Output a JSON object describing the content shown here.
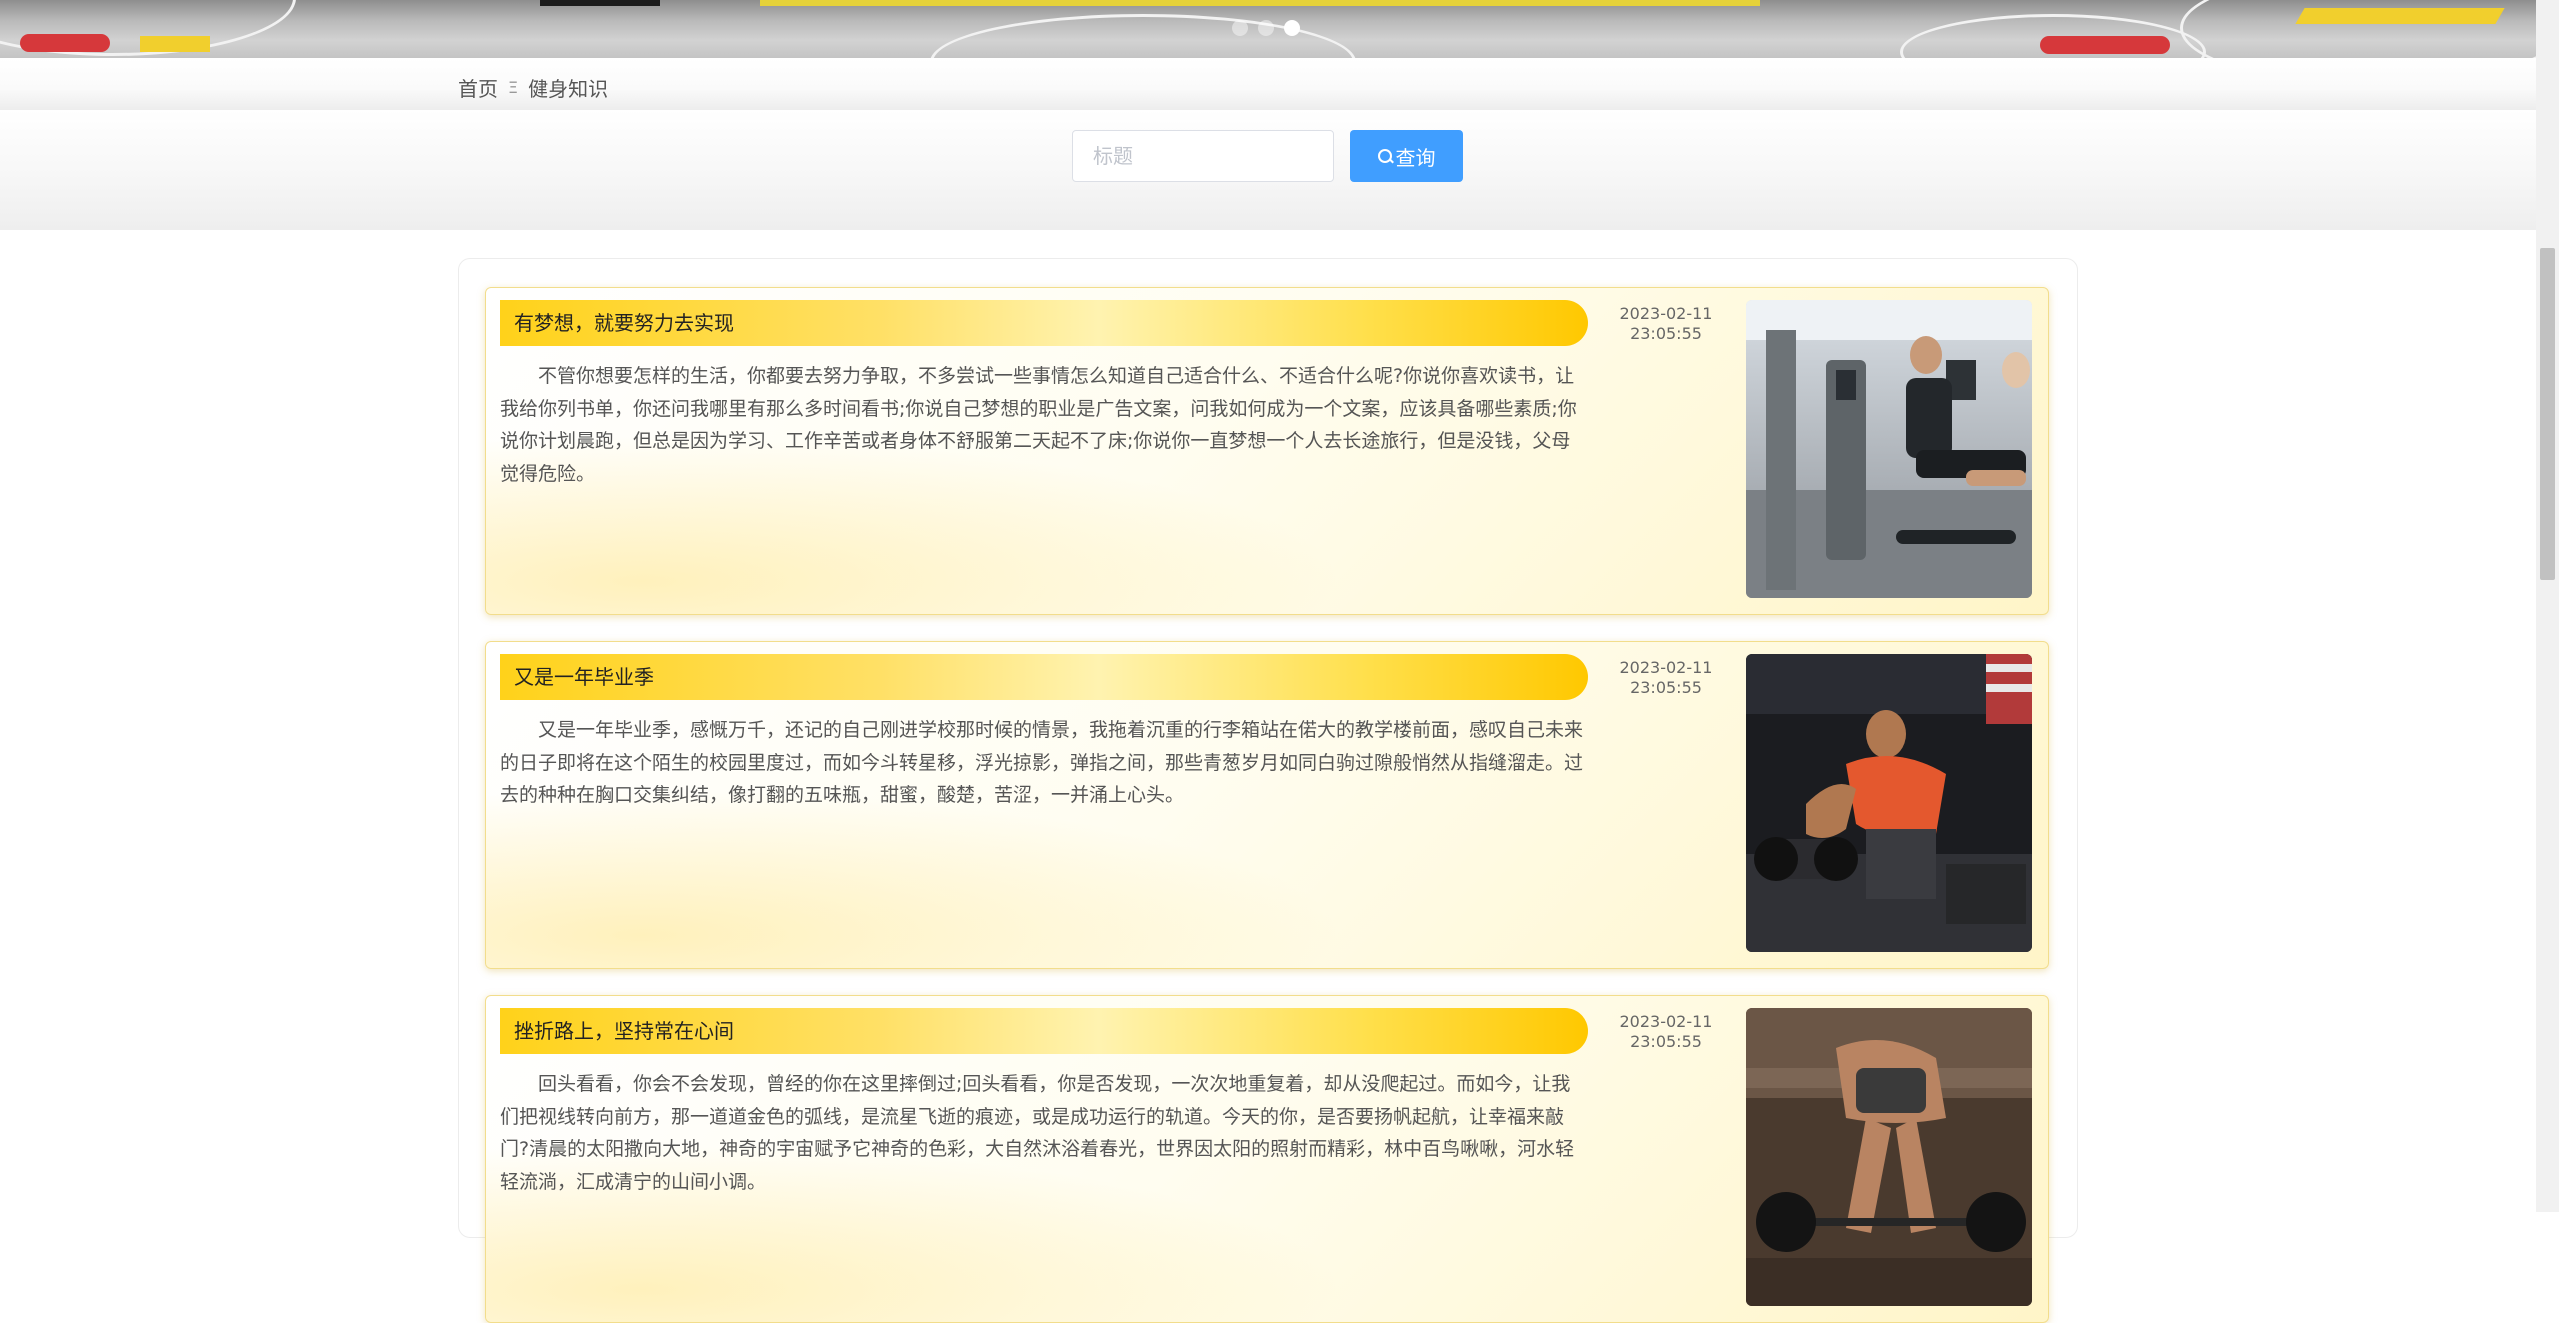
{
  "banner": {
    "carousel_dots": 3,
    "active_dot": 3
  },
  "breadcrumb": {
    "home_label": "首页",
    "separator": "Ξ",
    "current_label": "健身知识"
  },
  "search": {
    "placeholder": "标题",
    "value": "",
    "button_label": "查询"
  },
  "articles": [
    {
      "title": "有梦想，就要努力去实现",
      "date": "2023-02-11",
      "time": "23:05:55",
      "content": "不管你想要怎样的生活，你都要去努力争取，不多尝试一些事情怎么知道自己适合什么、不适合什么呢?你说你喜欢读书，让我给你列书单，你还问我哪里有那么多时间看书;你说自己梦想的职业是广告文案，问我如何成为一个文案，应该具备哪些素质;你说你计划晨跑，但总是因为学习、工作辛苦或者身体不舒服第二天起不了床;你说你一直梦想一个人去长途旅行，但是没钱，父母觉得危险。",
      "image": "gym-cardio-photo"
    },
    {
      "title": "又是一年毕业季",
      "date": "2023-02-11",
      "time": "23:05:55",
      "content": "又是一年毕业季，感慨万千，还记的自己刚进学校那时候的情景，我拖着沉重的行李箱站在偌大的教学楼前面，感叹自己未来的日子即将在这个陌生的校园里度过，而如今斗转星移，浮光掠影，弹指之间，那些青葱岁月如同白驹过隙般悄然从指缝溜走。过去的种种在胸口交集纠结，像打翻的五味瓶，甜蜜，酸楚，苦涩，一并涌上心头。",
      "image": "dumbbell-row-photo"
    },
    {
      "title": "挫折路上，坚持常在心间",
      "date": "2023-02-11",
      "time": "23:05:55",
      "content": "回头看看，你会不会发现，曾经的你在这里摔倒过;回头看看，你是否发现，一次次地重复着，却从没爬起过。而如今，让我们把视线转向前方，那一道道金色的弧线，是流星飞逝的痕迹，或是成功运行的轨道。今天的你，是否要扬帆起航，让幸福来敲门?清晨的太阳撒向大地，神奇的宇宙赋予它神奇的色彩，大自然沐浴着春光，世界因太阳的照射而精彩，林中百鸟啾啾，河水轻轻流淌，汇成清宁的山间小调。",
      "image": "deadlift-photo"
    }
  ],
  "colors": {
    "primary_button": "#409eff",
    "title_bar_gold": "#ffd21a",
    "card_border": "#f2dd8c"
  }
}
